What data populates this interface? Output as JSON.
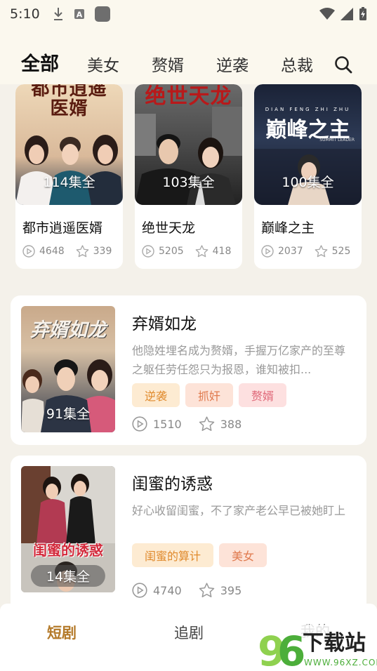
{
  "status_bar": {
    "time": "5:10",
    "icons": [
      "download-icon",
      "a-icon",
      "app-icon",
      "wifi-icon",
      "signal-icon",
      "battery-icon"
    ]
  },
  "header": {
    "tabs": [
      {
        "label": "全部",
        "active": true
      },
      {
        "label": "美女",
        "active": false
      },
      {
        "label": "赘婿",
        "active": false
      },
      {
        "label": "逆袭",
        "active": false
      },
      {
        "label": "总裁",
        "active": false
      }
    ],
    "search_icon": "search-icon"
  },
  "grid_cards": [
    {
      "cover_text": "都市逍遥医婿",
      "episodes": "114集全",
      "title": "都市逍遥医婿",
      "plays": "4648",
      "stars": "339",
      "cover_color": "#e9c9a3"
    },
    {
      "cover_text": "绝世天龙",
      "episodes": "103集全",
      "title": "绝世天龙",
      "plays": "5205",
      "stars": "418",
      "cover_color": "#5a5a5a"
    },
    {
      "cover_text": "巅峰之主",
      "cover_sub": "SUMMIT LEADER",
      "cover_top": "DIAN FENG ZHI ZHU",
      "episodes": "100集全",
      "title": "巅峰之主",
      "plays": "2037",
      "stars": "525",
      "cover_color": "#27324a"
    }
  ],
  "list_cards": [
    {
      "cover_text": "弃婿如龙",
      "episodes": "91集全",
      "title": "弃婿如龙",
      "desc": "他隐姓埋名成为赘婿，手握万亿家产的至尊之躯任劳任怨只为报恩，谁知被扣...",
      "tags": [
        "逆袭",
        "抓奸",
        "赘婿"
      ],
      "plays": "1510",
      "stars": "388"
    },
    {
      "cover_text": "闺蜜的诱惑",
      "episodes": "14集全",
      "title": "闺蜜的诱惑",
      "desc": "好心收留闺蜜，不了家产老公早已被她盯上",
      "tags": [
        "闺蜜的算计",
        "美女"
      ],
      "plays": "4740",
      "stars": "395"
    }
  ],
  "bottom_nav": {
    "items": [
      {
        "label": "短剧",
        "active": true
      },
      {
        "label": "追剧",
        "active": false
      },
      {
        "label": "我的",
        "active": false
      }
    ]
  },
  "watermark": {
    "brand": "96",
    "text": "下载站",
    "url": "WWW.96XZ.COM"
  },
  "colors": {
    "accent": "#b47a2a",
    "page_bg": "#f4f1ea",
    "header_bg": "#fbf8ee"
  }
}
